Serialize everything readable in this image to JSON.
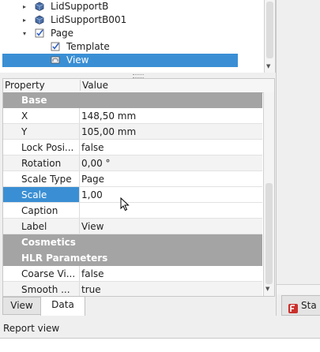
{
  "tree": {
    "items": [
      {
        "label": "LidSupportB",
        "arrow": "▸",
        "icon": "part-icon"
      },
      {
        "label": "LidSupportB001",
        "arrow": "▸",
        "icon": "part-icon"
      },
      {
        "label": "Page",
        "arrow": "▾",
        "icon": "page-icon"
      },
      {
        "label": "Template",
        "arrow": "",
        "icon": "template-icon"
      },
      {
        "label": "View",
        "arrow": "",
        "icon": "view-icon",
        "selected": true
      }
    ]
  },
  "property_table": {
    "headers": {
      "property": "Property",
      "value": "Value"
    },
    "rows": [
      {
        "type": "group",
        "property": "Base"
      },
      {
        "property": "X",
        "value": "148,50 mm"
      },
      {
        "property": "Y",
        "value": "105,00 mm"
      },
      {
        "property": "Lock Posi...",
        "value": "false"
      },
      {
        "property": "Rotation",
        "value": "0,00 °"
      },
      {
        "property": "Scale Type",
        "value": "Page"
      },
      {
        "property": "Scale",
        "value": "1,00",
        "selected": true
      },
      {
        "property": "Caption",
        "value": ""
      },
      {
        "property": "Label",
        "value": "View"
      },
      {
        "type": "group",
        "property": "Cosmetics"
      },
      {
        "type": "group",
        "property": "HLR Parameters"
      },
      {
        "property": "Coarse Vi...",
        "value": "false"
      },
      {
        "property": "Smooth ...",
        "value": "true"
      }
    ]
  },
  "tabs": {
    "view": "View",
    "data": "Data",
    "active": "Data"
  },
  "right_tab": {
    "label": "Sta"
  },
  "report": {
    "title": "Report view"
  },
  "colors": {
    "selection": "#3a8fd4",
    "group_bg": "#a4a4a4"
  }
}
